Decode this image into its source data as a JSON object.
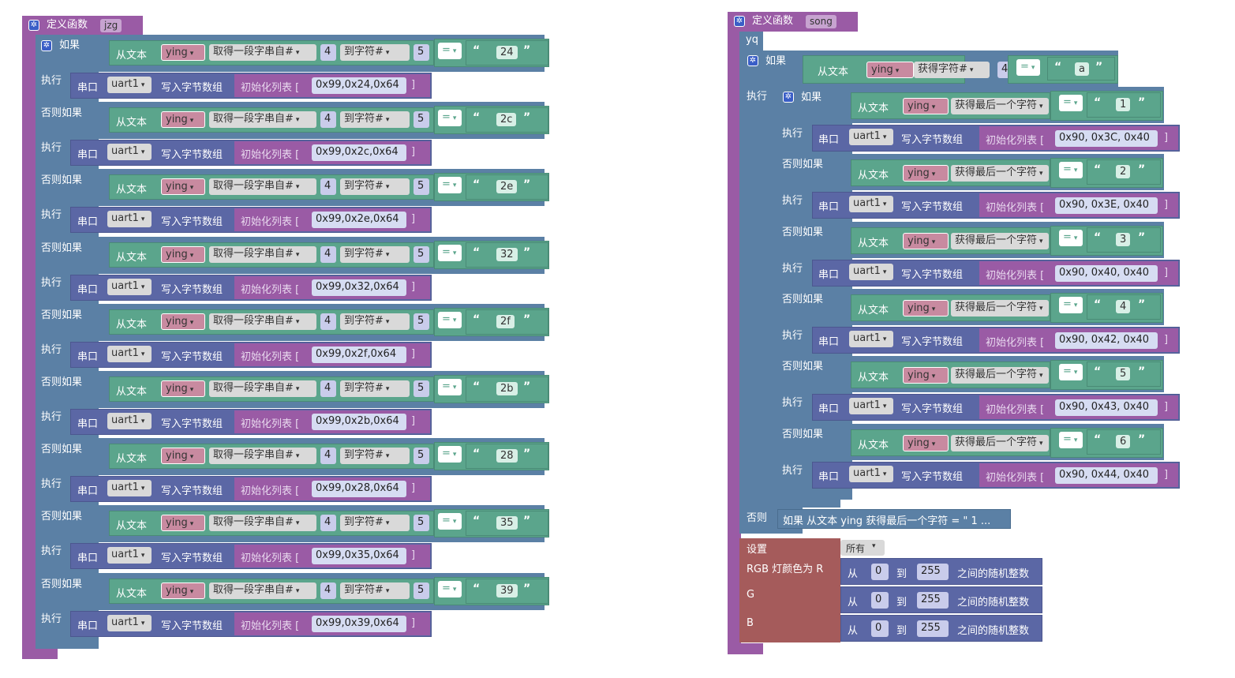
{
  "colors": {
    "function_block": "#9a5ba5",
    "control_block": "#5b80a5",
    "text_block": "#5ba58c",
    "serial_block": "#5b67a5",
    "list_block": "#9a5ba5",
    "variable_block": "#a55b80",
    "rgb_block": "#a55b5b",
    "math_block": "#5b67a5"
  },
  "labels": {
    "define_function": "定义函数",
    "if": "如果",
    "do": "执行",
    "else_if": "否则如果",
    "else": "否则",
    "from_text": "从文本",
    "get_substring_from": "取得一段字串自#",
    "to_char": "到字符#",
    "get_char": "获得字符#",
    "get_last_char": "获得最后一个字符",
    "serial": "串口",
    "write_bytes": "写入字节数组",
    "init_list": "初始化列表 [",
    "list_close": "]",
    "eq": "=",
    "dropdown_caret": "▾",
    "quote_open": "“",
    "quote_close": "”"
  },
  "left_function": {
    "name": "jzg",
    "var": "ying",
    "uart": "uart1",
    "substring_from": "4",
    "substring_to": "5",
    "branches": [
      {
        "compare": "24",
        "bytes": "0x99,0x24,0x64"
      },
      {
        "compare": "2c",
        "bytes": "0x99,0x2c,0x64"
      },
      {
        "compare": "2e",
        "bytes": "0x99,0x2e,0x64"
      },
      {
        "compare": "32",
        "bytes": "0x99,0x32,0x64"
      },
      {
        "compare": "2f",
        "bytes": "0x99,0x2f,0x64"
      },
      {
        "compare": "2b",
        "bytes": "0x99,0x2b,0x64"
      },
      {
        "compare": "28",
        "bytes": "0x99,0x28,0x64"
      },
      {
        "compare": "35",
        "bytes": "0x99,0x35,0x64"
      },
      {
        "compare": "39",
        "bytes": "0x99,0x39,0x64"
      }
    ]
  },
  "right_function": {
    "name": "song",
    "stack_label": "yq",
    "var": "ying",
    "uart": "uart1",
    "char_index": "4",
    "outer_compare": "a",
    "branches": [
      {
        "compare": "1",
        "bytes": "0x90, 0x3C, 0x40"
      },
      {
        "compare": "2",
        "bytes": "0x90, 0x3E, 0x40"
      },
      {
        "compare": "3",
        "bytes": "0x90, 0x40, 0x40"
      },
      {
        "compare": "4",
        "bytes": "0x90, 0x42, 0x40"
      },
      {
        "compare": "5",
        "bytes": "0x90, 0x43, 0x40"
      },
      {
        "compare": "6",
        "bytes": "0x90, 0x44, 0x40"
      }
    ],
    "else_collapsed": "如果 从文本 ying 获得最后一个字符 = \" 1 ...",
    "rgb": {
      "set_label": "设置",
      "target": "所有",
      "color_label": "RGB 灯颜色为 R",
      "g_label": "G",
      "b_label": "B",
      "from": "从",
      "to": "到",
      "random_int": "之间的随机整数",
      "rows": [
        {
          "min": "0",
          "max": "255"
        },
        {
          "min": "0",
          "max": "255"
        },
        {
          "min": "0",
          "max": "255"
        }
      ]
    }
  }
}
